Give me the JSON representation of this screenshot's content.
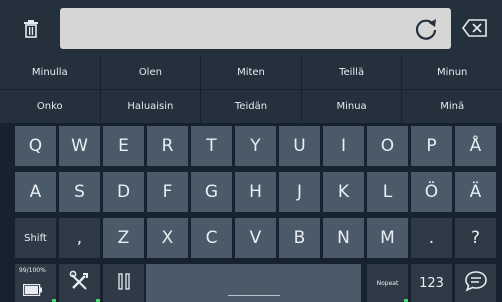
{
  "topbar": {
    "trash_icon": "trash-icon",
    "refresh_icon": "refresh-icon",
    "backspace_icon": "backspace-icon",
    "input_value": ""
  },
  "suggestions": {
    "row1": [
      "Minulla",
      "Olen",
      "Miten",
      "Teillä",
      "Minun"
    ],
    "row2": [
      "Onko",
      "Haluaisin",
      "Teidän",
      "Minua",
      "Minä"
    ]
  },
  "keys": {
    "row1": [
      "Q",
      "W",
      "E",
      "R",
      "T",
      "Y",
      "U",
      "I",
      "O",
      "P",
      "Å"
    ],
    "row2": [
      "A",
      "S",
      "D",
      "F",
      "G",
      "H",
      "J",
      "K",
      "L",
      "Ö",
      "Ä"
    ],
    "row3": [
      "Shift",
      ",",
      "Z",
      "X",
      "C",
      "V",
      "B",
      "N",
      "M",
      ".",
      "?"
    ],
    "bottom": {
      "battery_text": "99/100%",
      "battery_icon": "battery-icon",
      "tools_icon": "tools-icon",
      "pause_icon": "pause-icon",
      "nopeat": "Nopeat",
      "numbers": "123",
      "chat_icon": "chat-icon"
    }
  },
  "colors": {
    "background": "#16222d",
    "key": "#4a5a69",
    "key_dark": "#2e3b47",
    "suggestion": "#24313d",
    "input": "#d6d6d6",
    "accent": "#44d06a"
  }
}
